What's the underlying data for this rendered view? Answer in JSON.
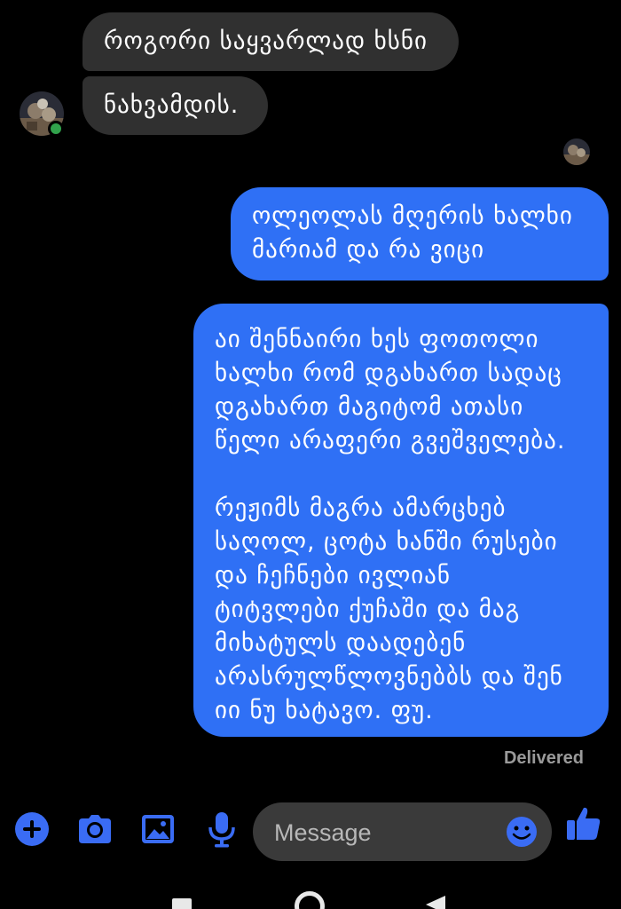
{
  "conversation": {
    "incoming": [
      {
        "text": "როგორი საყვარლად ხსნი"
      },
      {
        "text": "ნახვამდის."
      }
    ],
    "outgoing": [
      {
        "text": "ოლეოლას მღერის ხალხი\nმარიამ და რა ვიცი"
      },
      {
        "text": "აი შენნაირი ხეს ფოთოლი\nხალხი რომ დგახართ სადაც\nდგახართ მაგიტომ ათასი\nწელი არაფერი გვეშველება.\n\nრეჟიმს მაგრა ამარცხებ\nსაღოლ, ცოტა ხანში რუსები\nდა ჩეჩნები ივლიან\nტიტვლები ქუჩაში და მაგ\nმიხატულს დაადებენ\nარასრულწლოვნებბს და შენ\nიი ნუ ხატავო. ფუ."
      }
    ],
    "status": "Delivered"
  },
  "composer": {
    "placeholder": "Message",
    "icons": [
      "plus-circle-icon",
      "camera-icon",
      "image-icon",
      "microphone-icon",
      "emoji-icon",
      "thumbs-up-icon"
    ]
  },
  "navigation": {
    "icons": [
      "recents-icon",
      "home-icon",
      "back-icon"
    ]
  },
  "colors": {
    "background": "#000000",
    "incoming_bubble": "#303030",
    "outgoing_bubble": "#2f70f5",
    "accent": "#3a6cf4",
    "online": "#31a24c",
    "status_text": "#9a9a9a"
  }
}
